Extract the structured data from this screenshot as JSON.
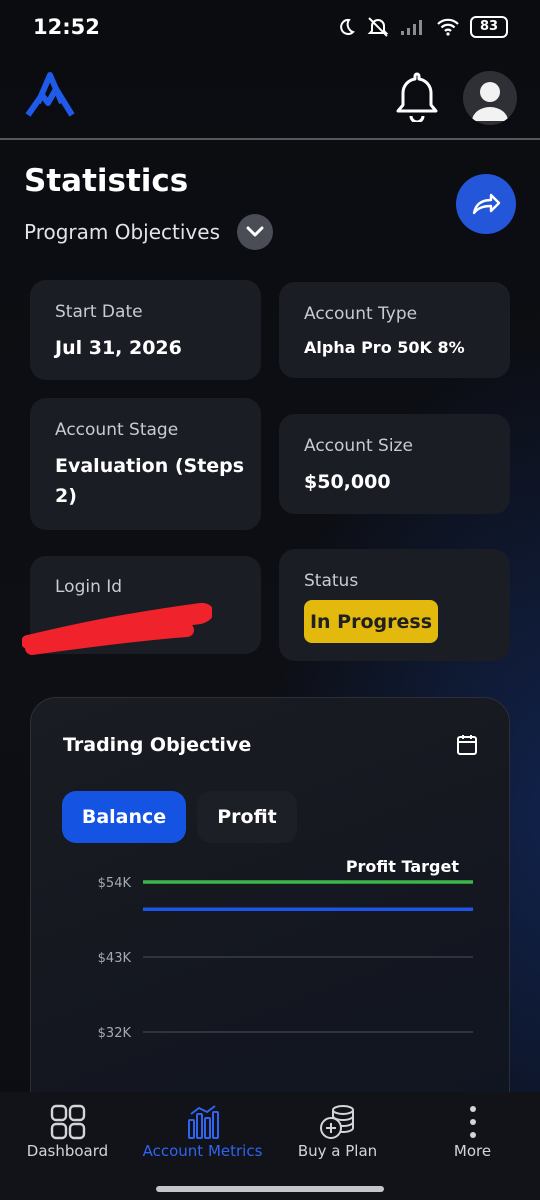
{
  "status_bar": {
    "time": "12:52",
    "battery": "83"
  },
  "header": {
    "logo_icon": "brand-logo-icon",
    "bell_icon": "bell-icon",
    "avatar_icon": "user-avatar-icon"
  },
  "page": {
    "title": "Statistics",
    "subtitle": "Program Objectives"
  },
  "cards": {
    "start_date": {
      "label": "Start Date",
      "value": "Jul 31, 2026"
    },
    "account_type": {
      "label": "Account Type",
      "value": "Alpha Pro 50K 8%"
    },
    "account_stage": {
      "label": "Account Stage",
      "value": "Evaluation (Steps 2)"
    },
    "account_size": {
      "label": "Account Size",
      "value": "$50,000"
    },
    "login_id": {
      "label": "Login Id"
    },
    "status": {
      "label": "Status",
      "value": "In Progress"
    }
  },
  "trading_objective": {
    "title": "Trading Objective",
    "tabs": [
      {
        "label": "Balance",
        "active": true
      },
      {
        "label": "Profit",
        "active": false
      }
    ]
  },
  "chart_data": {
    "type": "line",
    "title": "",
    "xlabel": "",
    "ylabel": "",
    "y_ticks": [
      "$54K",
      "$43K",
      "$32K"
    ],
    "ylim": [
      32000,
      54000
    ],
    "grid": true,
    "annotations": [
      {
        "text": "Profit Target"
      }
    ],
    "series": [
      {
        "name": "Profit Target",
        "color": "#3cb64a",
        "values": [
          54000,
          54000
        ]
      },
      {
        "color": "#1e55e8",
        "values": [
          50000,
          50000
        ]
      }
    ]
  },
  "bottom_nav": {
    "items": [
      {
        "label": "Dashboard",
        "icon": "dashboard-grid-icon",
        "active": false
      },
      {
        "label": "Account Metrics",
        "icon": "bar-chart-icon",
        "active": true
      },
      {
        "label": "Buy a Plan",
        "icon": "coins-add-icon",
        "active": false
      },
      {
        "label": "More",
        "icon": "more-dots-icon",
        "active": false
      }
    ]
  },
  "colors": {
    "accent": "#1554e3",
    "status_badge": "#e3b90e",
    "active_nav": "#2f63f0"
  }
}
